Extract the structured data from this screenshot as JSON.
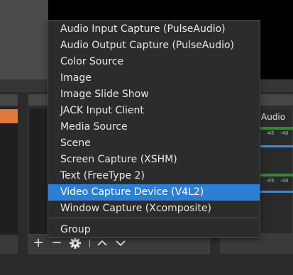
{
  "mixer": {
    "track_label": "Audio",
    "meter_ticks": [
      "-45",
      "-40"
    ]
  },
  "sources_toolbar": {
    "add_icon": "+",
    "remove_icon": "−",
    "settings_icon": "gear-icon",
    "up_icon": "chevron-up-icon",
    "down_icon": "chevron-down-icon"
  },
  "context_menu": {
    "items": [
      "Audio Input Capture (PulseAudio)",
      "Audio Output Capture (PulseAudio)",
      "Color Source",
      "Image",
      "Image Slide Show",
      "JACK Input Client",
      "Media Source",
      "Scene",
      "Screen Capture (XSHM)",
      "Text (FreeType 2)",
      "Video Capture Device (V4L2)",
      "Window Capture (Xcomposite)",
      "Group"
    ],
    "selected_item": "Video Capture Device (V4L2)"
  },
  "colors": {
    "selection": "#2d7fd6",
    "scene_highlight": "#dd7a3b",
    "meter_green": "#2f8a2f"
  }
}
